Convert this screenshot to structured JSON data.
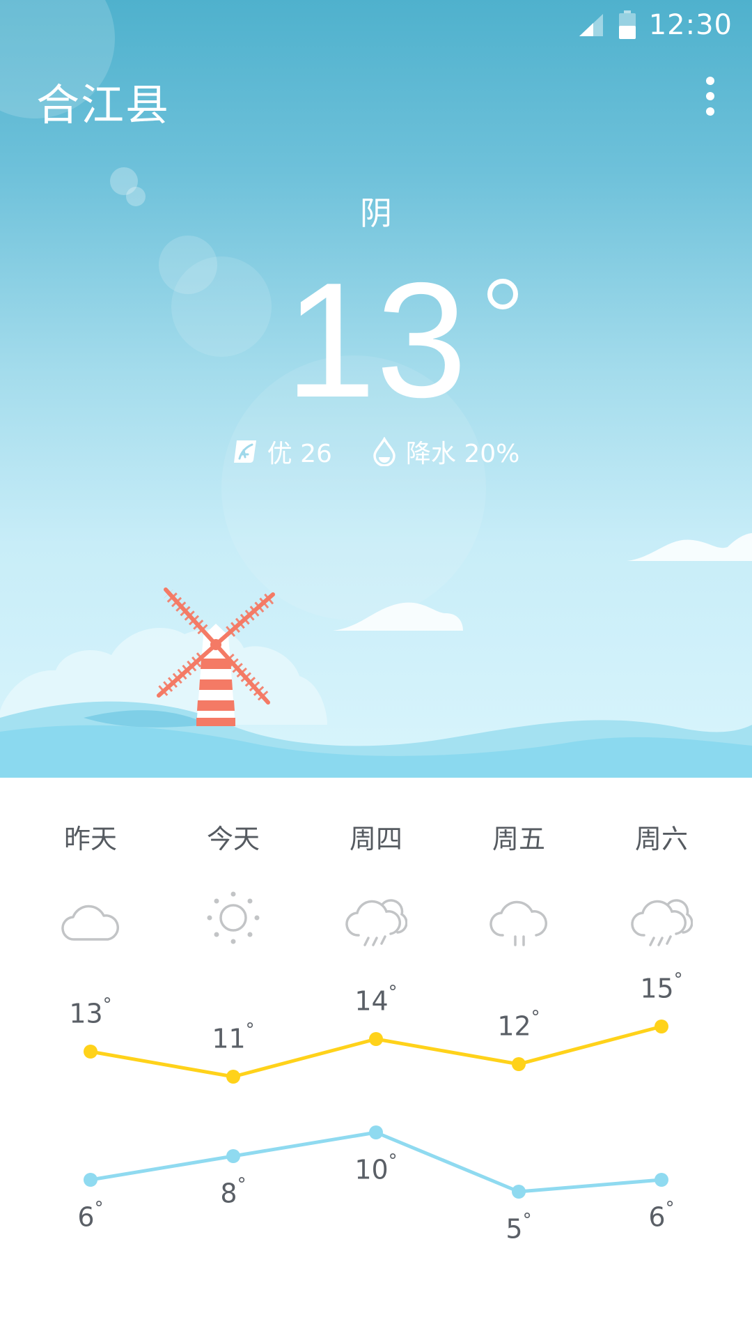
{
  "status_bar": {
    "time": "12:30"
  },
  "header": {
    "city": "合江县"
  },
  "current": {
    "condition": "阴",
    "temperature": "13",
    "air_quality": "优 26",
    "precipitation": "降水 20%"
  },
  "forecast": {
    "days": [
      {
        "label": "昨天",
        "icon": "cloud-icon",
        "high": "13",
        "low": "6"
      },
      {
        "label": "今天",
        "icon": "sun-icon",
        "high": "11",
        "low": "8"
      },
      {
        "label": "周四",
        "icon": "cloud-rain-sun-icon",
        "high": "14",
        "low": "10"
      },
      {
        "label": "周五",
        "icon": "cloud-rain-icon",
        "high": "12",
        "low": "5"
      },
      {
        "label": "周六",
        "icon": "cloud-rain-sun-icon",
        "high": "15",
        "low": "6"
      }
    ],
    "colors": {
      "high": "#ffd21a",
      "low": "#8fdaf0"
    }
  },
  "chart_data": {
    "type": "line",
    "categories": [
      "昨天",
      "今天",
      "周四",
      "周五",
      "周六"
    ],
    "series": [
      {
        "values": [
          13,
          11,
          14,
          12,
          15
        ]
      },
      {
        "values": [
          6,
          8,
          10,
          5,
          6
        ]
      }
    ]
  }
}
